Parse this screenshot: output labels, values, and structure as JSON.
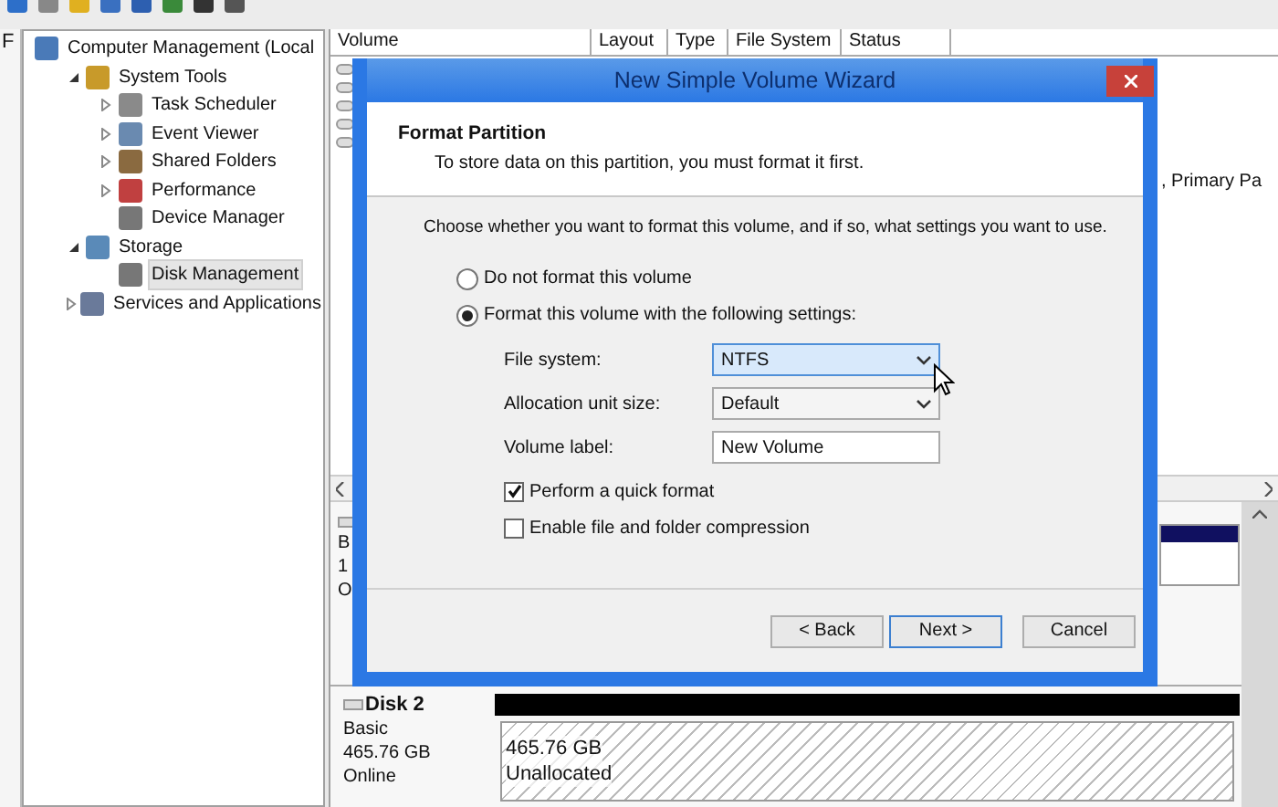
{
  "left_fragment": "F",
  "tree": [
    {
      "label": "Computer Management (Local",
      "selected": false,
      "children": [
        {
          "label": "System Tools",
          "expanded": true,
          "selected": false,
          "children": [
            {
              "label": "Task Scheduler",
              "expanded": false,
              "selected": false
            },
            {
              "label": "Event Viewer",
              "expanded": false,
              "selected": false
            },
            {
              "label": "Shared Folders",
              "expanded": false,
              "selected": false
            },
            {
              "label": "Performance",
              "expanded": false,
              "selected": false
            },
            {
              "label": "Device Manager",
              "selected": false
            }
          ]
        },
        {
          "label": "Storage",
          "expanded": true,
          "selected": false,
          "children": [
            {
              "label": "Disk Management",
              "selected": true
            }
          ]
        },
        {
          "label": "Services and Applications",
          "expanded": false,
          "selected": false
        }
      ]
    }
  ],
  "volume_table": {
    "columns": [
      "Volume",
      "Layout",
      "Type",
      "File System",
      "Status"
    ],
    "status_fragment": ", Primary Pa"
  },
  "disks": [
    {
      "lines": [
        "B",
        "1",
        "O"
      ]
    },
    {
      "name": "Disk 2",
      "lines": [
        "Basic",
        "465.76 GB",
        "Online"
      ],
      "partition": {
        "size": "465.76 GB",
        "state": "Unallocated"
      }
    }
  ],
  "dialog": {
    "title": "New Simple Volume Wizard",
    "header": {
      "title": "Format Partition",
      "subtitle": "To store data on this partition, you must format it first."
    },
    "prompt": "Choose whether you want to format this volume, and if so, what settings you want to use.",
    "options": [
      {
        "label": "Do not format this volume",
        "selected": false
      },
      {
        "label": "Format this volume with the following settings:",
        "selected": true
      }
    ],
    "fields": [
      {
        "label": "File system:",
        "kind": "select",
        "value": "NTFS",
        "hovered": true
      },
      {
        "label": "Allocation unit size:",
        "kind": "select",
        "value": "Default",
        "hovered": false
      },
      {
        "label": "Volume label:",
        "kind": "text",
        "value": "New Volume"
      }
    ],
    "checkboxes": [
      {
        "label": "Perform a quick format",
        "checked": true
      },
      {
        "label": "Enable file and folder compression",
        "checked": false
      }
    ],
    "buttons": [
      {
        "label": "< Back",
        "focused": false
      },
      {
        "label": "Next >",
        "focused": true
      },
      {
        "label": "Cancel",
        "focused": false
      }
    ]
  }
}
